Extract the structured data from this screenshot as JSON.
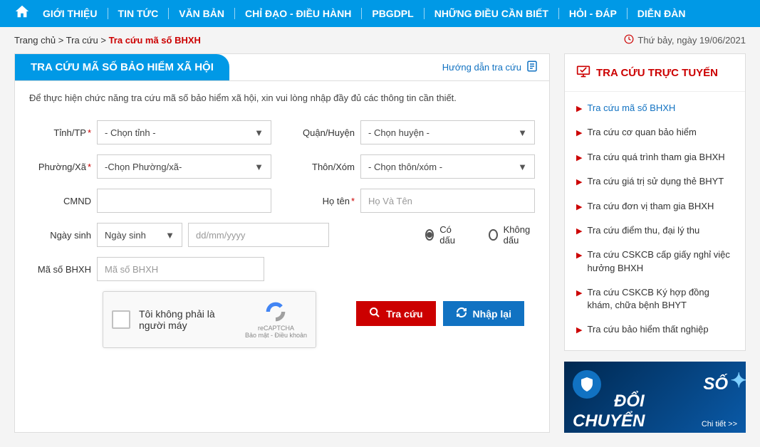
{
  "nav": {
    "items": [
      "GIỚI THIỆU",
      "TIN TỨC",
      "VĂN BẢN",
      "CHỈ ĐẠO - ĐIỀU HÀNH",
      "PBGDPL",
      "NHỮNG ĐIỀU CẦN BIẾT",
      "HỎI - ĐÁP",
      "DIỄN ĐÀN"
    ]
  },
  "breadcrumb": {
    "home": "Trang chủ",
    "sep": ">",
    "level1": "Tra cứu",
    "current": "Tra cứu mã số BHXH"
  },
  "date_text": "Thứ bảy, ngày 19/06/2021",
  "main": {
    "title": "TRA CỨU MÃ SỐ BẢO HIỂM XÃ HỘI",
    "guide": "Hướng dẫn tra cứu",
    "desc": "Để thực hiện chức năng tra cứu mã số bảo hiểm xã hội, xin vui lòng nhập đầy đủ các thông tin cần thiết."
  },
  "form": {
    "tinh_tp": {
      "label": "Tỉnh/TP",
      "required": true,
      "value": "- Chọn tỉnh -"
    },
    "quan_huyen": {
      "label": "Quận/Huyện",
      "value": "- Chọn huyện -"
    },
    "phuong_xa": {
      "label": "Phường/Xã",
      "required": true,
      "value": "-Chọn Phường/xã-"
    },
    "thon_xom": {
      "label": "Thôn/Xóm",
      "value": "- Chọn thôn/xóm -"
    },
    "cmnd": {
      "label": "CMND",
      "value": ""
    },
    "ho_ten": {
      "label": "Họ tên",
      "required": true,
      "placeholder": "Họ Và Tên"
    },
    "ngay_sinh": {
      "label": "Ngày sinh",
      "type_value": "Ngày sinh",
      "placeholder": "dd/mm/yyyy"
    },
    "ma_so": {
      "label": "Mã số BHXH",
      "placeholder": "Mã số BHXH"
    },
    "radio_co_dau": "Có dấu",
    "radio_khong_dau": "Không dấu",
    "btn_search": "Tra cứu",
    "btn_reset": "Nhập lại"
  },
  "recaptcha": {
    "text": "Tôi không phải là người máy",
    "brand": "reCAPTCHA",
    "terms": "Bảo mật - Điều khoản"
  },
  "sidebar": {
    "title": "TRA CỨU TRỰC TUYẾN",
    "items": [
      "Tra cứu mã số BHXH",
      "Tra cứu cơ quan bảo hiểm",
      "Tra cứu quá trình tham gia BHXH",
      "Tra cứu giá trị sử dụng thẻ BHYT",
      "Tra cứu đơn vị tham gia BHXH",
      "Tra cứu điểm thu, đại lý thu",
      "Tra cứu CSKCB cấp giấy nghỉ việc hưởng BHXH",
      "Tra cứu CSKCB Ký hợp đồng khám, chữa bệnh BHYT",
      "Tra cứu bảo hiểm thất nghiệp"
    ]
  },
  "banner": {
    "t1": "SỐ",
    "t2": "ĐỔI",
    "t3": "CHUYỂN",
    "more": "Chi tiết >>"
  }
}
